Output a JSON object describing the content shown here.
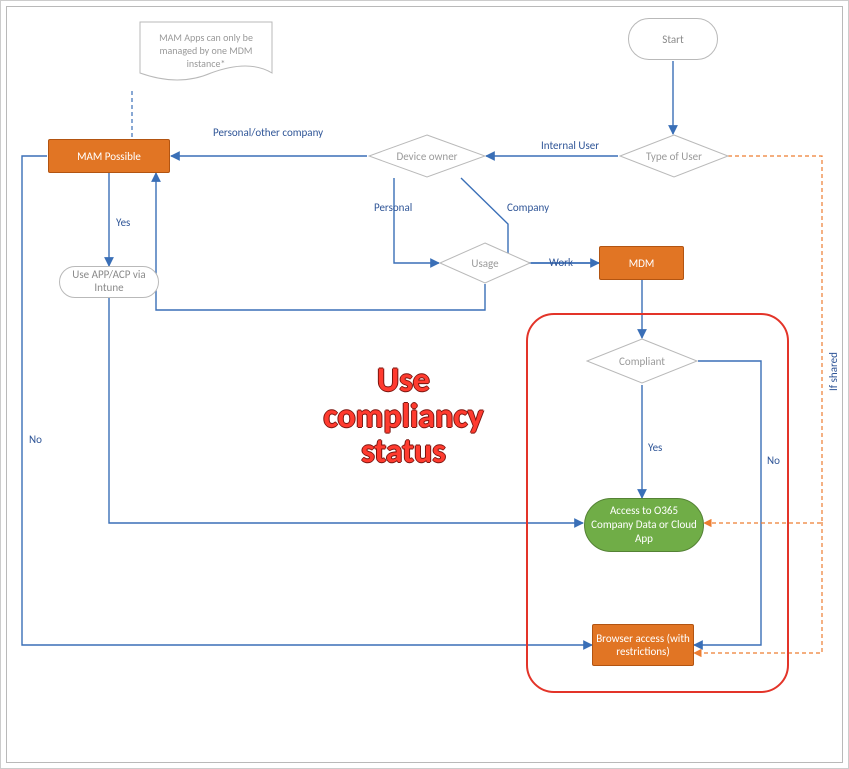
{
  "colors": {
    "blue": "#3a6fb7",
    "orange": "#ed7d31",
    "red": "#e33429",
    "green": "#70ad47",
    "grey": "#9a9a9a"
  },
  "note": {
    "text": "MAM Apps can only be managed by one MDM instance*"
  },
  "nodes": {
    "start": "Start",
    "type_of_user": "Type of User",
    "device_owner": "Device owner",
    "mam_possible": "MAM Possible",
    "usage": "Usage",
    "mdm": "MDM",
    "compliant": "Compliant",
    "use_app_acp": "Use APP/ACP via Intune",
    "access_o365": "Access to O365 Company Data or Cloud App",
    "browser_access": "Browser access (with restrictions)"
  },
  "edges": {
    "internal_user": "Internal User",
    "personal_other": "Personal/other company",
    "personal": "Personal",
    "company": "Company",
    "work": "Work",
    "yes_mam": "Yes",
    "no_mam": "No",
    "yes_compliant": "Yes",
    "no_compliant": "No",
    "if_shared": "If shared"
  },
  "callout": "Use compliancy status"
}
